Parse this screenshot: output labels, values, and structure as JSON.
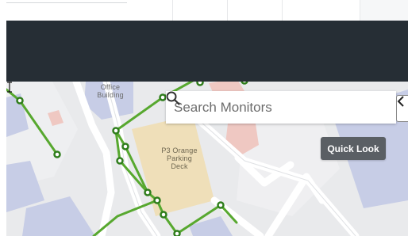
{
  "map": {
    "office_label_line1": "Office",
    "office_label_line2": "Building",
    "parking_label_line1": "P3 Orange",
    "parking_label_line2": "Parking",
    "parking_label_line3": "Deck",
    "route_color": "#57a82f",
    "node_color": "#2f7d1c",
    "building_color": "#c7cde6",
    "parking_color": "#efdfb9",
    "road_color": "#ffffff",
    "highlight_building_color": "#efc8c2"
  },
  "search": {
    "placeholder": "Search Monitors",
    "value": "",
    "icon": "search-icon"
  },
  "panel": {
    "collapse_icon": "chevron-left-icon"
  },
  "quick_look": {
    "label": "Quick Look",
    "color": "#5a5f64"
  },
  "header": {
    "color": "#262e35"
  }
}
